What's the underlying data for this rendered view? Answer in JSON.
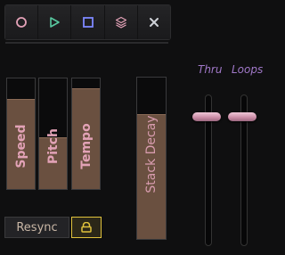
{
  "toolbar": {
    "buttons": [
      {
        "icon": "circle-icon",
        "color": "#e4a2b8"
      },
      {
        "icon": "play-triangle-icon",
        "color": "#58c8a0"
      },
      {
        "icon": "stop-square-icon",
        "color": "#7d88ff"
      },
      {
        "icon": "layers-icon",
        "color": "#e4a2b8"
      },
      {
        "icon": "close-x-icon",
        "color": "#cfd2d8"
      }
    ]
  },
  "faders": [
    {
      "label": "Speed",
      "level": 0.81
    },
    {
      "label": "Pitch",
      "level": 0.46
    },
    {
      "label": "Tempo",
      "level": 0.9
    }
  ],
  "stack_decay": {
    "label": "Stack Decay",
    "level": 0.77
  },
  "resync_label": "Resync",
  "lock": {
    "active": true
  },
  "sliders": [
    {
      "label": "Thru",
      "level": 0.86
    },
    {
      "label": "Loops",
      "level": 0.86
    }
  ],
  "colors": {
    "accent_pink": "#e4a2b8",
    "label_purple": "#a078c8",
    "fill_brown": "#6a5040",
    "lock_yellow": "#e0c23c"
  }
}
